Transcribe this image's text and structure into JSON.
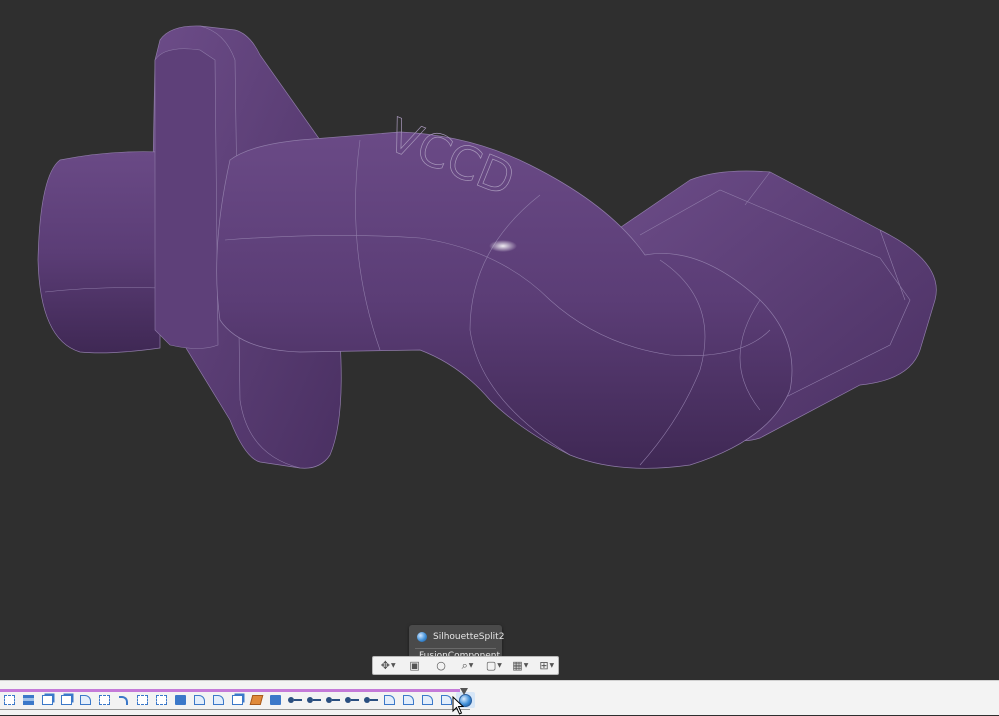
{
  "viewport": {
    "background": "#2f2f2f",
    "model_color": "#5a3d73",
    "model_edge_color": "#8f7ba8",
    "engraving_text": "VCCD"
  },
  "tooltip": {
    "icon": "silhouette-split-icon",
    "feature_name": "SilhouetteSplit2",
    "feature_type": "FusionComponent"
  },
  "navbar": {
    "buttons": [
      {
        "icon": "orbit-icon",
        "has_dropdown": true
      },
      {
        "icon": "look-at-icon",
        "has_dropdown": false
      },
      {
        "icon": "pan-icon",
        "has_dropdown": false
      },
      {
        "icon": "zoom-icon",
        "has_dropdown": true
      },
      {
        "icon": "display-settings-icon",
        "has_dropdown": true
      },
      {
        "icon": "grid-icon",
        "has_dropdown": true
      },
      {
        "icon": "viewports-icon",
        "has_dropdown": true
      }
    ]
  },
  "timeline": {
    "marker_color": "#c47ad8",
    "features": [
      "sketch-icon",
      "plane-icon",
      "box-icon",
      "box-icon",
      "fillet-icon",
      "sketch-icon",
      "sweep-icon",
      "move-icon",
      "sketch-icon",
      "extrude-icon",
      "fillet-icon",
      "shell-icon",
      "emboss-icon",
      "layers-icon",
      "combine-icon",
      "split-icon",
      "split-icon",
      "split-icon",
      "split-icon",
      "split-icon",
      "fillet-icon",
      "fillet-icon",
      "fillet-icon",
      "fillet-icon",
      "silhouette-split-icon"
    ]
  }
}
